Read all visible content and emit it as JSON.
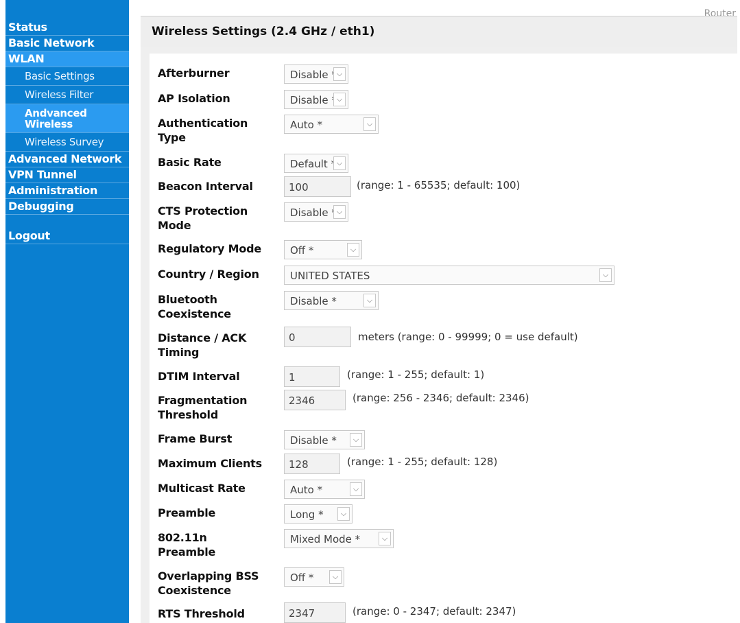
{
  "header": {
    "corner_text": "Router",
    "title": "Wireless Settings (2.4 GHz / eth1)"
  },
  "sidebar": {
    "items": [
      {
        "label": "Status"
      },
      {
        "label": "Basic Network"
      },
      {
        "label": "WLAN"
      },
      {
        "label": "Basic Settings"
      },
      {
        "label": "Wireless Filter"
      },
      {
        "label": "Andvanced Wireless"
      },
      {
        "label": "Wireless Survey"
      },
      {
        "label": "Advanced Network"
      },
      {
        "label": "VPN Tunnel"
      },
      {
        "label": "Administration"
      },
      {
        "label": "Debugging"
      },
      {
        "label": "Logout"
      }
    ]
  },
  "form": {
    "afterburner": {
      "label": "Afterburner",
      "value": "Disable *"
    },
    "ap_isolation": {
      "label": "AP Isolation",
      "value": "Disable *"
    },
    "auth_type": {
      "label": "Authentication Type",
      "value": "Auto *"
    },
    "basic_rate": {
      "label": "Basic Rate",
      "value": "Default *"
    },
    "beacon_interval": {
      "label": "Beacon Interval",
      "value": "100",
      "hint": "(range: 1 - 65535; default: 100)"
    },
    "cts_protection": {
      "label": "CTS Protection Mode",
      "value": "Disable *"
    },
    "regulatory_mode": {
      "label": "Regulatory Mode",
      "value": "Off *"
    },
    "country_region": {
      "label": "Country / Region",
      "value": "UNITED STATES"
    },
    "bt_coexistence": {
      "label": "Bluetooth Coexistence",
      "value": "Disable *"
    },
    "distance_ack": {
      "label": "Distance / ACK Timing",
      "value": "0",
      "hint": "meters  (range: 0 - 99999; 0 = use default)"
    },
    "dtim_interval": {
      "label": "DTIM Interval",
      "value": "1",
      "hint": "(range: 1 - 255; default: 1)"
    },
    "frag_threshold": {
      "label": "Fragmentation Threshold",
      "value": "2346",
      "hint": "(range: 256 - 2346; default: 2346)"
    },
    "frame_burst": {
      "label": "Frame Burst",
      "value": "Disable *"
    },
    "max_clients": {
      "label": "Maximum Clients",
      "value": "128",
      "hint": "(range: 1 - 255; default: 128)"
    },
    "multicast_rate": {
      "label": "Multicast Rate",
      "value": "Auto *"
    },
    "preamble": {
      "label": "Preamble",
      "value": "Long *"
    },
    "n_preamble": {
      "label": "802.11n Preamble",
      "value": "Mixed Mode *"
    },
    "obss_coexistence": {
      "label": "Overlapping BSS Coexistence",
      "value": "Off *"
    },
    "rts_threshold": {
      "label": "RTS Threshold",
      "value": "2347",
      "hint": "(range: 0 - 2347; default: 2347)"
    }
  }
}
